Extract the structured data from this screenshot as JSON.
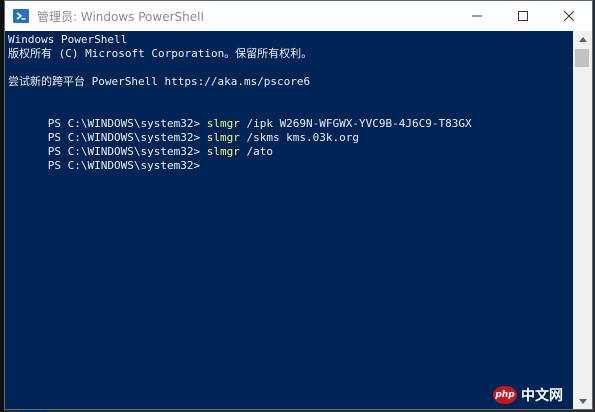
{
  "window": {
    "title": "管理员: Windows PowerShell"
  },
  "console": {
    "header": [
      "Windows PowerShell",
      "版权所有 (C) Microsoft Corporation。保留所有权利。",
      "",
      "尝试新的跨平台 PowerShell https://aka.ms/pscore6"
    ],
    "prompt": "PS C:\\WINDOWS\\system32> ",
    "commands": [
      {
        "name": "slmgr",
        "args": " /ipk W269N-WFGWX-YVC9B-4J6C9-T83GX"
      },
      {
        "name": "slmgr",
        "args": " /skms kms.03k.org"
      },
      {
        "name": "slmgr",
        "args": " /ato"
      }
    ]
  },
  "watermark": {
    "badge": "php",
    "text": "中文网"
  },
  "colors": {
    "console_bg": "#012456",
    "console_fg": "#eeedf0",
    "command_fg": "#f6f28a"
  },
  "icons": {
    "app": "powershell-icon",
    "minimize": "minimize-icon",
    "maximize": "maximize-icon",
    "close": "close-icon"
  }
}
